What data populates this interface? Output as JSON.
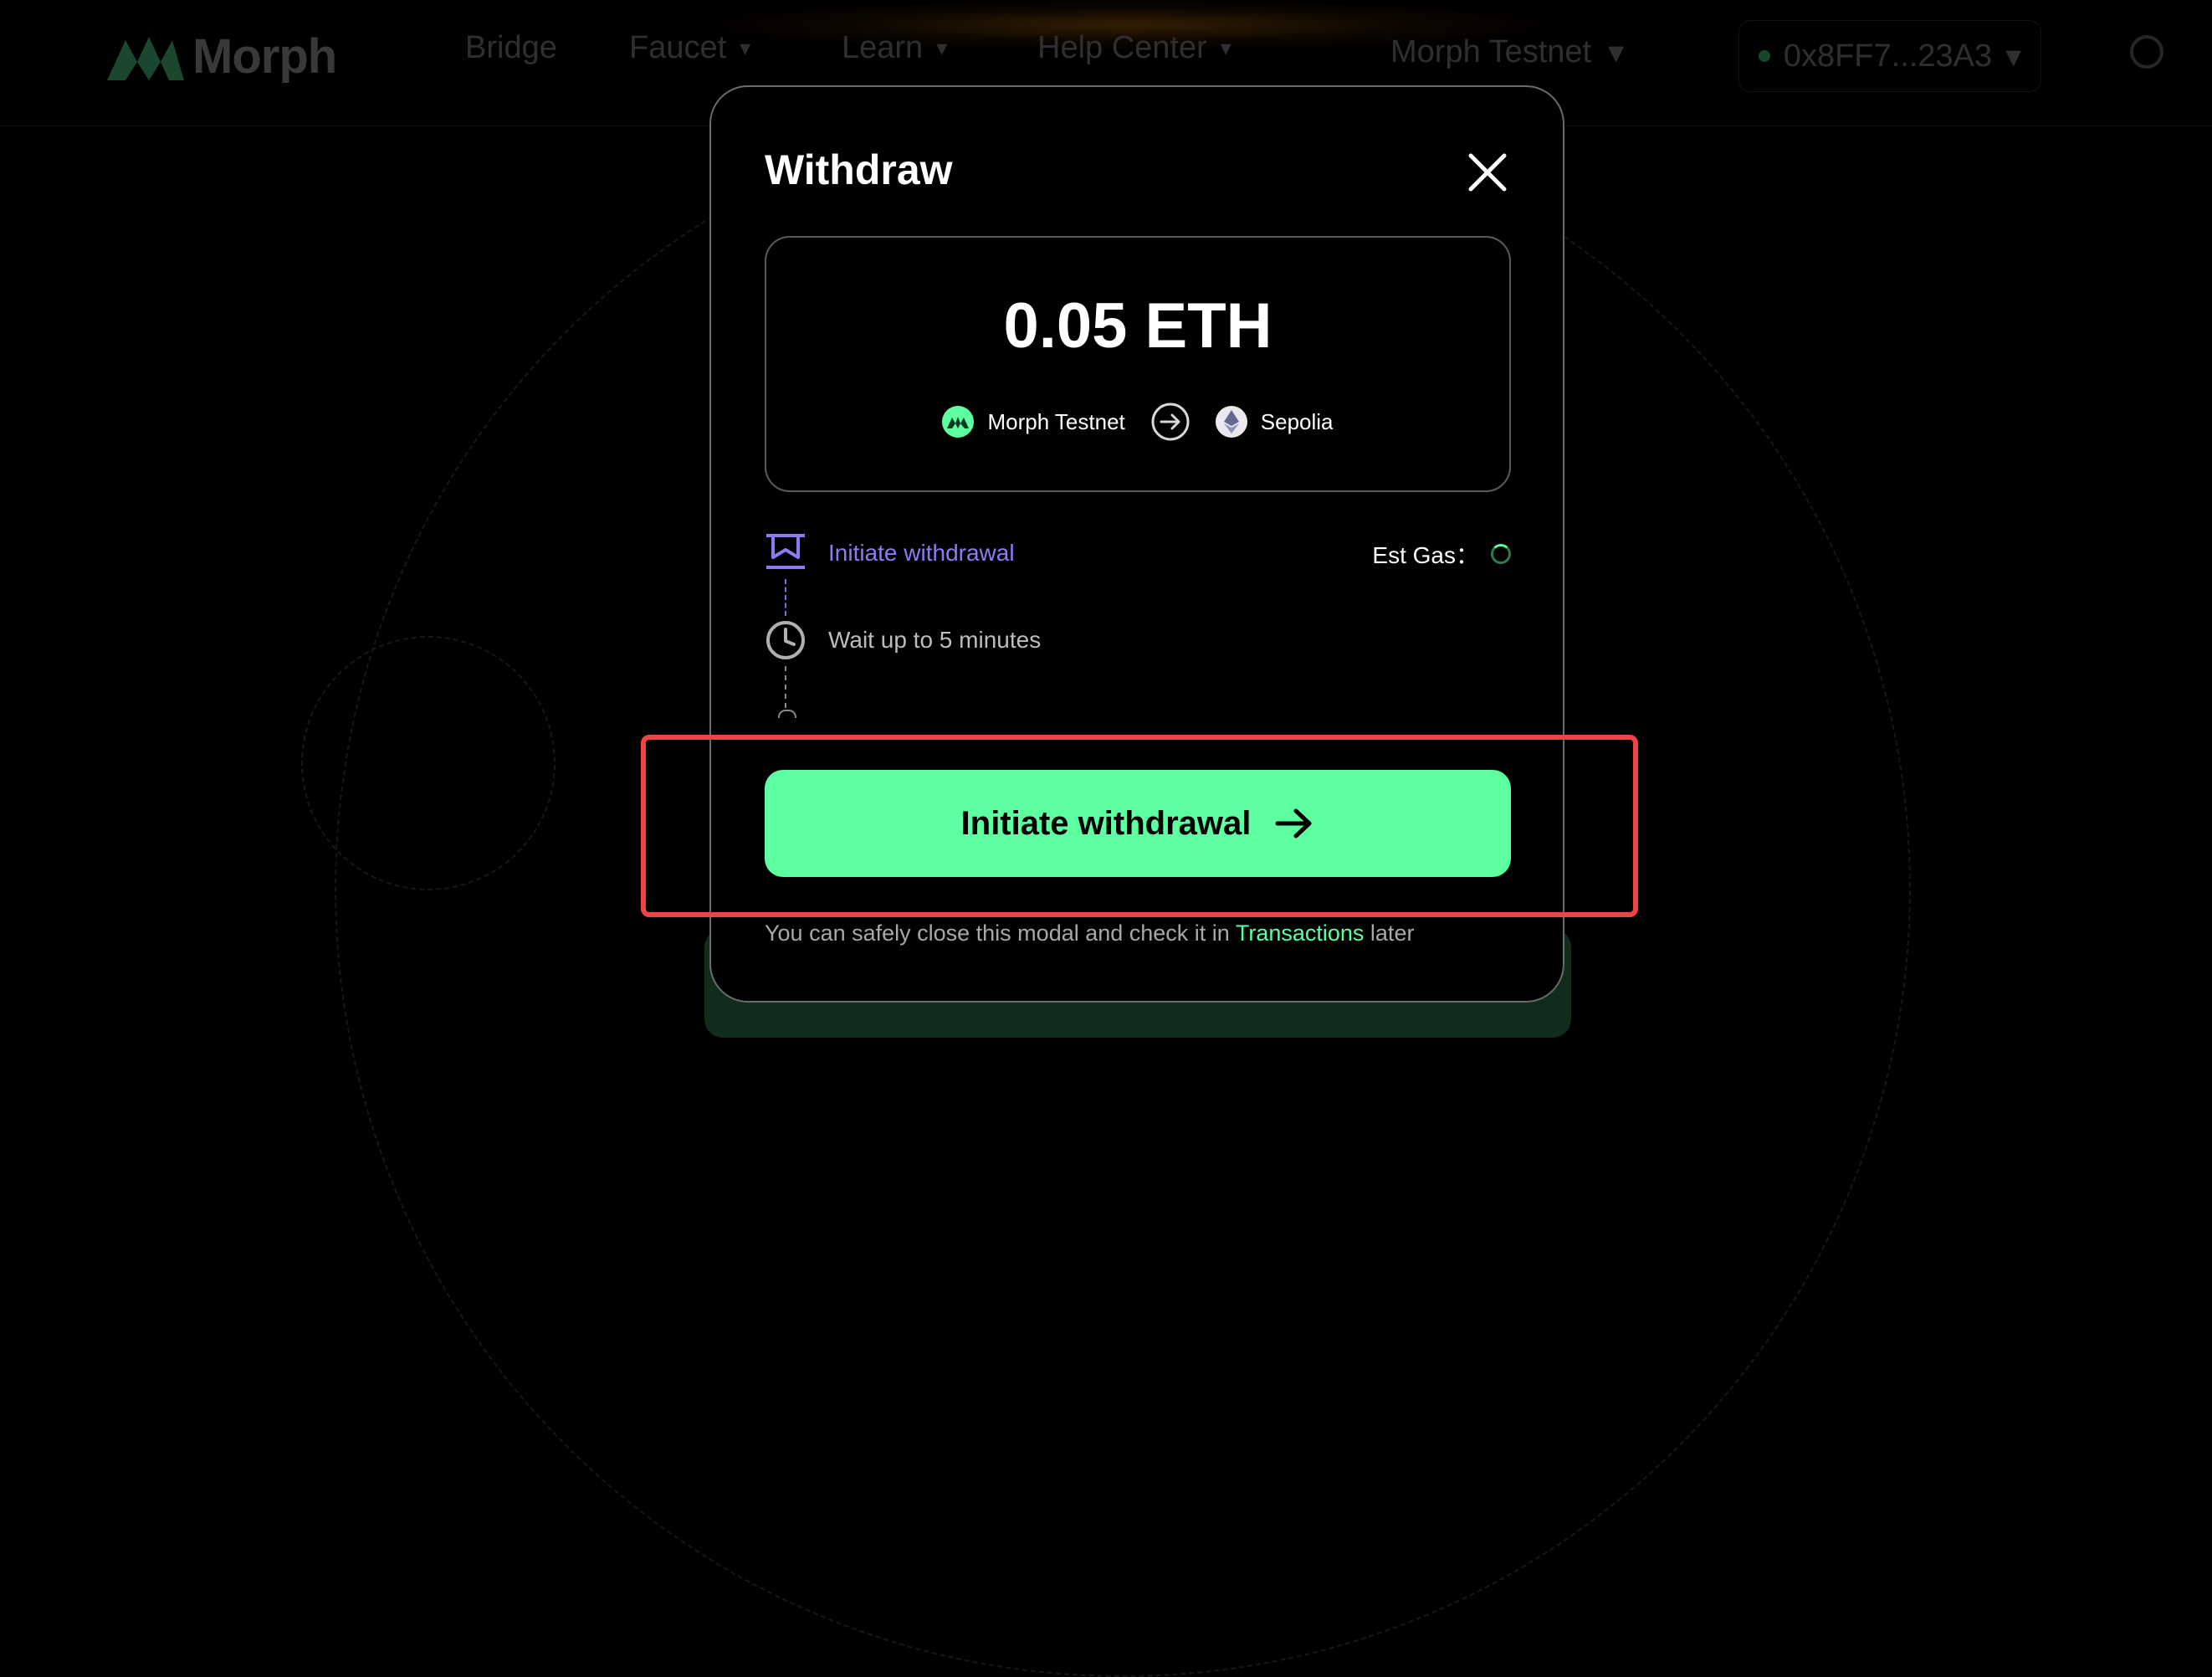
{
  "background": {
    "brand": "Morph",
    "nav": [
      {
        "label": "Bridge",
        "dropdown": false
      },
      {
        "label": "Faucet",
        "dropdown": true
      },
      {
        "label": "Learn",
        "dropdown": true
      },
      {
        "label": "Help Center",
        "dropdown": true
      }
    ],
    "network": "Morph Testnet",
    "wallet": "0x8FF7...23A3"
  },
  "modal": {
    "title": "Withdraw",
    "amount": "0.05 ETH",
    "from_chain": "Morph Testnet",
    "to_chain": "Sepolia",
    "steps": [
      {
        "label": "Initiate withdrawal",
        "status": "active"
      },
      {
        "label": "Wait up to 5 minutes",
        "status": "pending"
      }
    ],
    "gas_label": "Est Gas：",
    "primary_button": "Initiate withdrawal",
    "note_before": "You can safely close this modal and check it in",
    "note_link": "Transactions",
    "note_after": "later"
  },
  "colors": {
    "accent_green": "#5effa0",
    "step_active": "#8b7cf6",
    "highlight": "#ee4444"
  }
}
